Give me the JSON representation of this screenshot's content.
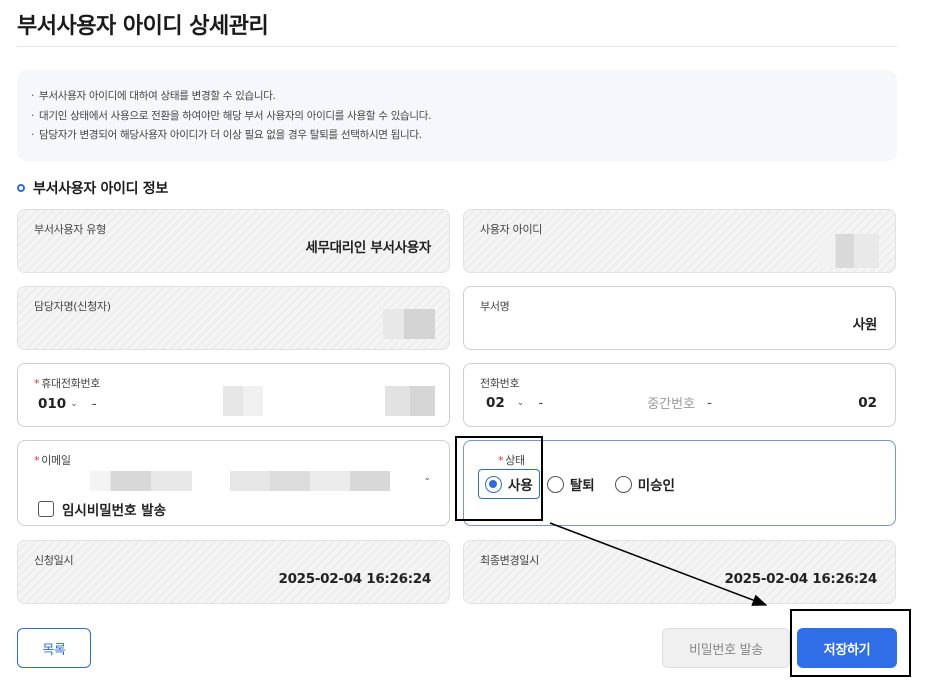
{
  "page": {
    "title": "부서사용자 아이디 상세관리"
  },
  "notice": {
    "lines": [
      "부서사용자 아이디에 대하여 상태를 변경할 수 있습니다.",
      "대기인 상태에서 사용으로 전환을 하여야만 해당 부서 사용자의 아이디를 사용할 수 있습니다.",
      "담당자가 변경되어 해당사용자 아이디가 더 이상 필요 없을 경우 탈퇴를 선택하시면 됩니다."
    ]
  },
  "section": {
    "title": "부서사용자 아이디 정보"
  },
  "fields": {
    "user_type": {
      "label": "부서사용자 유형",
      "value": "세무대리인 부서사용자"
    },
    "user_id": {
      "label": "사용자 아이디"
    },
    "manager_name": {
      "label": "담당자명(신청자)"
    },
    "dept_name": {
      "label": "부서명",
      "value": "사원"
    },
    "mobile": {
      "label": "휴대전화번호",
      "prefix": "010",
      "dash": "-"
    },
    "phone": {
      "label": "전화번호",
      "prefix": "02",
      "dash": "-",
      "middle_placeholder": "중간번호",
      "dash2": "-",
      "last": "02"
    },
    "email": {
      "label": "이메일",
      "temp_password_label": "임시비밀번호 발송"
    },
    "status": {
      "label": "상태",
      "options": [
        "사용",
        "탈퇴",
        "미승인"
      ],
      "selected": "사용"
    },
    "request_date": {
      "label": "신청일시",
      "value": "2025-02-04 16:26:24"
    },
    "last_modified": {
      "label": "최종변경일시",
      "value": "2025-02-04 16:26:24"
    }
  },
  "buttons": {
    "list": "목록",
    "send_password": "비밀번호 발송",
    "save": "저장하기"
  },
  "colors": {
    "accent": "#2f6ee6",
    "required": "#e03131"
  }
}
